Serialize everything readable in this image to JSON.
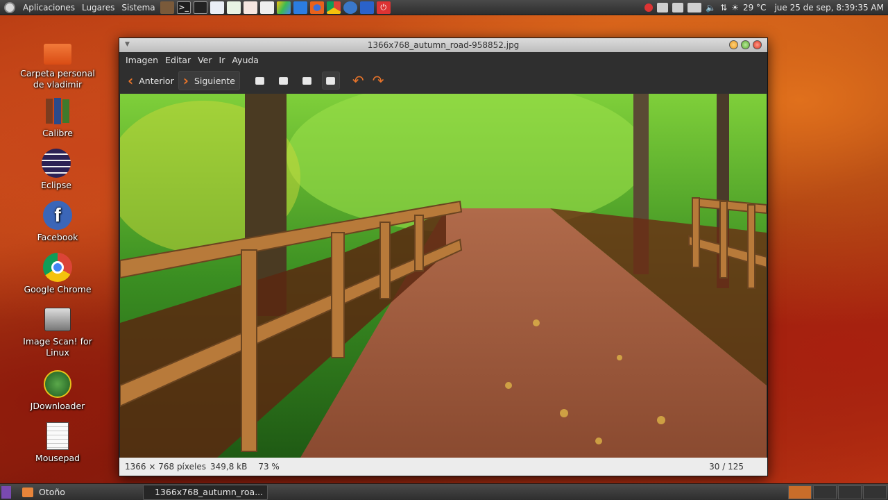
{
  "top_panel": {
    "menus": [
      "Aplicaciones",
      "Lugares",
      "Sistema"
    ],
    "weather": "29 °C",
    "datetime": "jue 25 de sep,  8:39:35 AM"
  },
  "desktop_icons": [
    {
      "label": "Carpeta personal de vladimir",
      "icon": "home-folder-icon"
    },
    {
      "label": "Calibre",
      "icon": "books-icon"
    },
    {
      "label": "Eclipse",
      "icon": "eclipse-icon"
    },
    {
      "label": "Facebook",
      "icon": "facebook-icon"
    },
    {
      "label": "Google Chrome",
      "icon": "chrome-icon"
    },
    {
      "label": "Image Scan! for Linux",
      "icon": "scanner-icon"
    },
    {
      "label": "JDownloader",
      "icon": "jdownloader-icon"
    },
    {
      "label": "Mousepad",
      "icon": "notepad-icon"
    }
  ],
  "window": {
    "title": "1366x768_autumn_road-958852.jpg",
    "menus": [
      "Imagen",
      "Editar",
      "Ver",
      "Ir",
      "Ayuda"
    ],
    "toolbar": {
      "prev_label": "Anterior",
      "next_label": "Siguiente"
    },
    "status": {
      "dimensions": "1366 × 768 píxeles",
      "size": "349,8 kB",
      "zoom": "73 %",
      "position": "30 / 125"
    }
  },
  "taskbar": {
    "items": [
      {
        "label": "Otoño"
      },
      {
        "label": "1366x768_autumn_roa..."
      }
    ]
  },
  "colors": {
    "accent": "#e8742a",
    "panel": "#2e2e2e"
  }
}
